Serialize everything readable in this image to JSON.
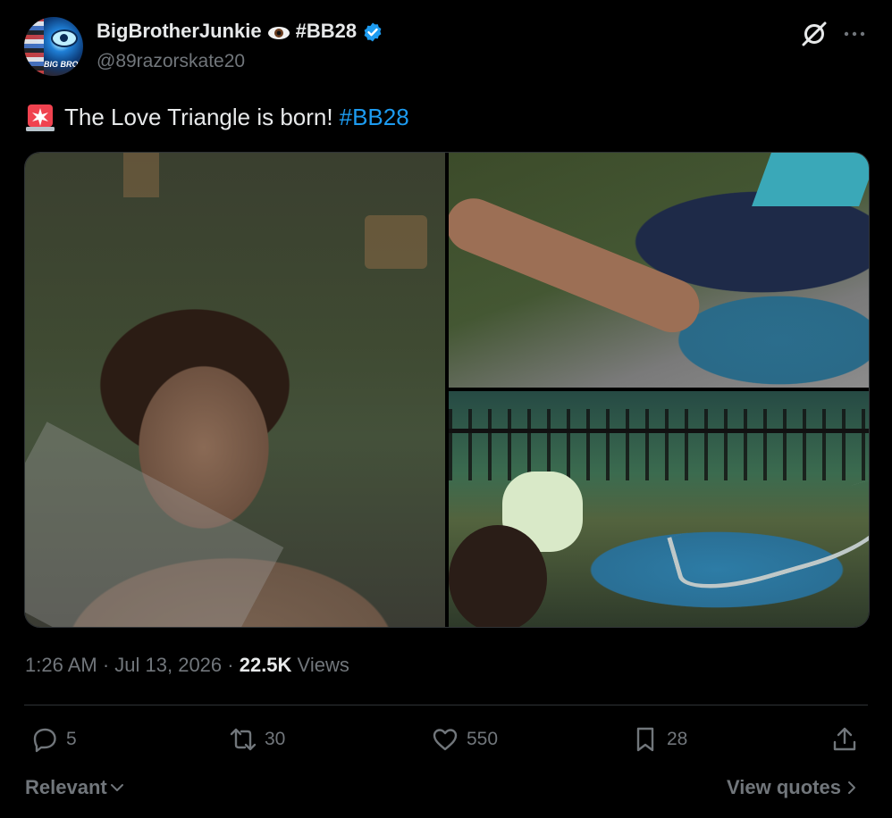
{
  "author": {
    "display_name": "BigBrotherJunkie",
    "name_hashtag": "#BB28",
    "handle": "@89razorskate20",
    "avatar_text": "BIG BRO"
  },
  "tweet": {
    "text": "The Love Triangle is born!",
    "hashtag": "#BB28"
  },
  "meta": {
    "time": "1:26 AM",
    "dot1": " · ",
    "date": "Jul 13, 2026",
    "dot2": " · ",
    "views_count": "22.5K",
    "views_label": " Views"
  },
  "actions": {
    "replies": "5",
    "reposts": "30",
    "likes": "550",
    "bookmarks": "28"
  },
  "footer": {
    "sort_label": "Relevant",
    "quotes_label": "View quotes"
  },
  "colors": {
    "accent": "#1d9bf0",
    "muted": "#71767b",
    "text": "#e7e9ea",
    "background": "#000000"
  }
}
